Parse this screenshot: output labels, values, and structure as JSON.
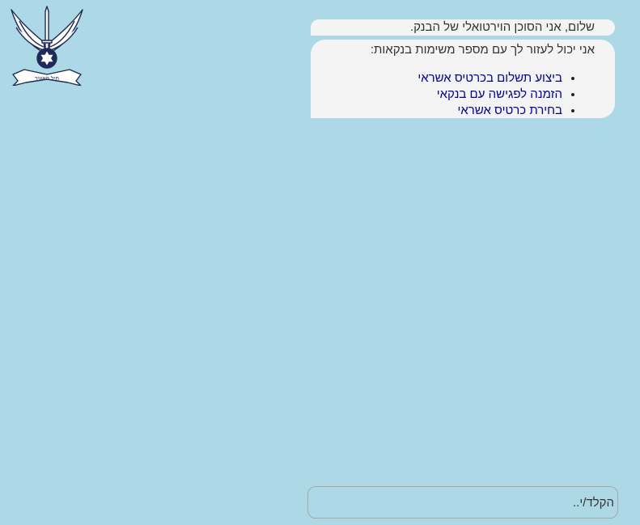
{
  "chat": {
    "greeting": "שלום, אני הסוכן הוירטואלי של הבנק.",
    "intro": "אני יכול לעזור לך עם מספר משימות בנקאות:",
    "options": [
      {
        "label": "ביצוע תשלום בכרטיס אשראי"
      },
      {
        "label": "הזמנה לפגישה עם בנקאי"
      },
      {
        "label": "בחירת כרטיס אשראי"
      }
    ]
  },
  "input": {
    "placeholder": "הקלד/י.."
  },
  "logo": {
    "icon": "air-force-emblem-icon",
    "text": "חיל האוויר"
  },
  "colors": {
    "background": "#add8e6",
    "bubble": "#f4f4f4",
    "link": "#0000a0"
  }
}
